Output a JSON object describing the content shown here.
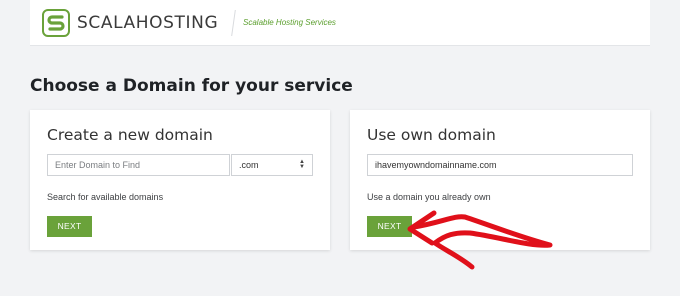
{
  "header": {
    "brand_name": "SCALAHOSTING",
    "tagline": "Scalable Hosting Services",
    "logo_icon": "scalahosting-logo-icon",
    "accent": "#5a9e2c"
  },
  "page": {
    "title": "Choose a Domain for your service"
  },
  "new_domain_card": {
    "heading": "Create a new domain",
    "input_placeholder": "Enter Domain to Find",
    "tld_value": ".com",
    "helper": "Search for available domains",
    "button_label": "NEXT"
  },
  "own_domain_card": {
    "heading": "Use own domain",
    "input_value": "ihavemyowndomainname.com",
    "helper": "Use a domain you already own",
    "button_label": "NEXT"
  },
  "colors": {
    "button": "#6aa23a",
    "annotation_arrow": "#e0101a"
  }
}
